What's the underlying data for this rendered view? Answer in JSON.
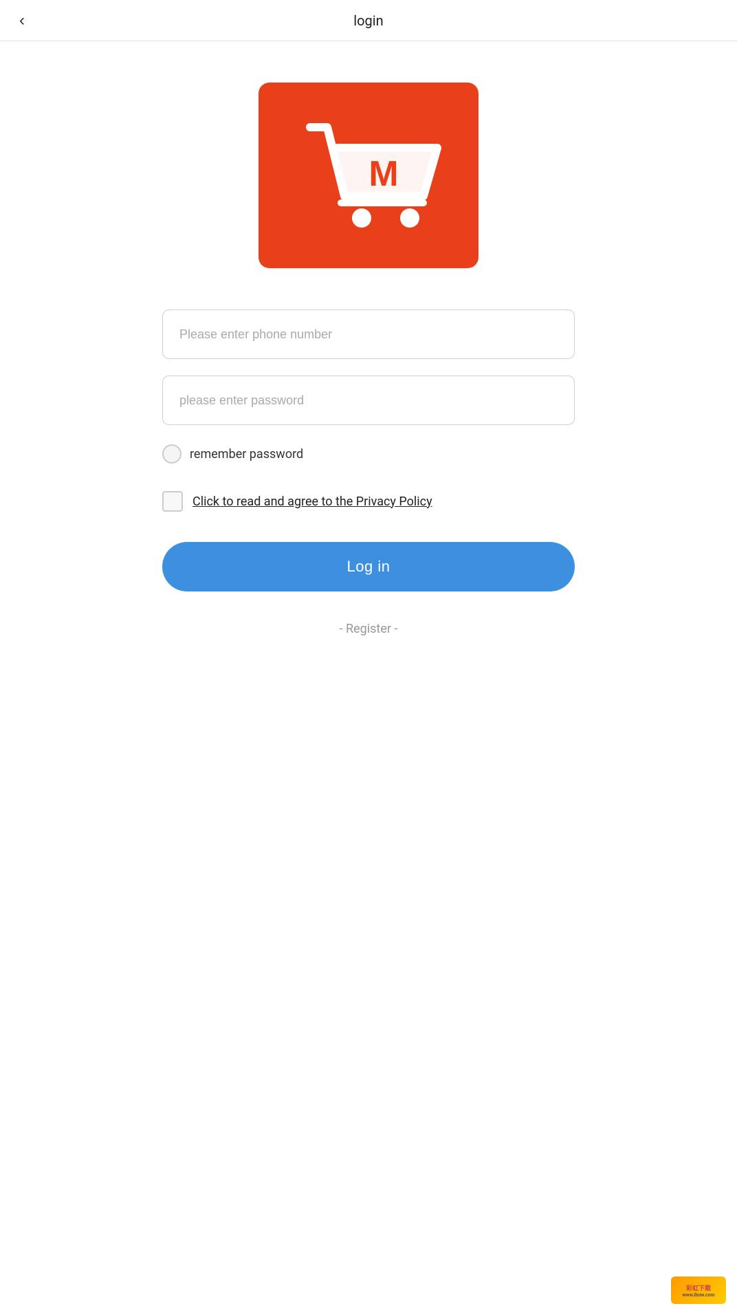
{
  "header": {
    "title": "login",
    "back_icon": "‹"
  },
  "logo": {
    "bg_color": "#e8401a",
    "letter": "M"
  },
  "form": {
    "phone_placeholder": "Please enter phone number",
    "password_placeholder": "please enter password",
    "remember_label": "remember password",
    "privacy_label": "Click to read and agree to the Privacy Policy",
    "login_button": "Log in",
    "register_label": "- Register -"
  }
}
